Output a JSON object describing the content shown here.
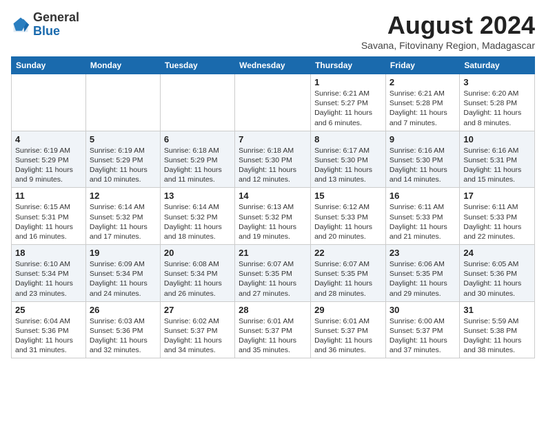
{
  "logo": {
    "general": "General",
    "blue": "Blue"
  },
  "header": {
    "month_year": "August 2024",
    "subtitle": "Savana, Fitovinany Region, Madagascar"
  },
  "weekdays": [
    "Sunday",
    "Monday",
    "Tuesday",
    "Wednesday",
    "Thursday",
    "Friday",
    "Saturday"
  ],
  "weeks": [
    [
      {
        "day": "",
        "info": ""
      },
      {
        "day": "",
        "info": ""
      },
      {
        "day": "",
        "info": ""
      },
      {
        "day": "",
        "info": ""
      },
      {
        "day": "1",
        "info": "Sunrise: 6:21 AM\nSunset: 5:27 PM\nDaylight: 11 hours and 6 minutes."
      },
      {
        "day": "2",
        "info": "Sunrise: 6:21 AM\nSunset: 5:28 PM\nDaylight: 11 hours and 7 minutes."
      },
      {
        "day": "3",
        "info": "Sunrise: 6:20 AM\nSunset: 5:28 PM\nDaylight: 11 hours and 8 minutes."
      }
    ],
    [
      {
        "day": "4",
        "info": "Sunrise: 6:19 AM\nSunset: 5:29 PM\nDaylight: 11 hours and 9 minutes."
      },
      {
        "day": "5",
        "info": "Sunrise: 6:19 AM\nSunset: 5:29 PM\nDaylight: 11 hours and 10 minutes."
      },
      {
        "day": "6",
        "info": "Sunrise: 6:18 AM\nSunset: 5:29 PM\nDaylight: 11 hours and 11 minutes."
      },
      {
        "day": "7",
        "info": "Sunrise: 6:18 AM\nSunset: 5:30 PM\nDaylight: 11 hours and 12 minutes."
      },
      {
        "day": "8",
        "info": "Sunrise: 6:17 AM\nSunset: 5:30 PM\nDaylight: 11 hours and 13 minutes."
      },
      {
        "day": "9",
        "info": "Sunrise: 6:16 AM\nSunset: 5:30 PM\nDaylight: 11 hours and 14 minutes."
      },
      {
        "day": "10",
        "info": "Sunrise: 6:16 AM\nSunset: 5:31 PM\nDaylight: 11 hours and 15 minutes."
      }
    ],
    [
      {
        "day": "11",
        "info": "Sunrise: 6:15 AM\nSunset: 5:31 PM\nDaylight: 11 hours and 16 minutes."
      },
      {
        "day": "12",
        "info": "Sunrise: 6:14 AM\nSunset: 5:32 PM\nDaylight: 11 hours and 17 minutes."
      },
      {
        "day": "13",
        "info": "Sunrise: 6:14 AM\nSunset: 5:32 PM\nDaylight: 11 hours and 18 minutes."
      },
      {
        "day": "14",
        "info": "Sunrise: 6:13 AM\nSunset: 5:32 PM\nDaylight: 11 hours and 19 minutes."
      },
      {
        "day": "15",
        "info": "Sunrise: 6:12 AM\nSunset: 5:33 PM\nDaylight: 11 hours and 20 minutes."
      },
      {
        "day": "16",
        "info": "Sunrise: 6:11 AM\nSunset: 5:33 PM\nDaylight: 11 hours and 21 minutes."
      },
      {
        "day": "17",
        "info": "Sunrise: 6:11 AM\nSunset: 5:33 PM\nDaylight: 11 hours and 22 minutes."
      }
    ],
    [
      {
        "day": "18",
        "info": "Sunrise: 6:10 AM\nSunset: 5:34 PM\nDaylight: 11 hours and 23 minutes."
      },
      {
        "day": "19",
        "info": "Sunrise: 6:09 AM\nSunset: 5:34 PM\nDaylight: 11 hours and 24 minutes."
      },
      {
        "day": "20",
        "info": "Sunrise: 6:08 AM\nSunset: 5:34 PM\nDaylight: 11 hours and 26 minutes."
      },
      {
        "day": "21",
        "info": "Sunrise: 6:07 AM\nSunset: 5:35 PM\nDaylight: 11 hours and 27 minutes."
      },
      {
        "day": "22",
        "info": "Sunrise: 6:07 AM\nSunset: 5:35 PM\nDaylight: 11 hours and 28 minutes."
      },
      {
        "day": "23",
        "info": "Sunrise: 6:06 AM\nSunset: 5:35 PM\nDaylight: 11 hours and 29 minutes."
      },
      {
        "day": "24",
        "info": "Sunrise: 6:05 AM\nSunset: 5:36 PM\nDaylight: 11 hours and 30 minutes."
      }
    ],
    [
      {
        "day": "25",
        "info": "Sunrise: 6:04 AM\nSunset: 5:36 PM\nDaylight: 11 hours and 31 minutes."
      },
      {
        "day": "26",
        "info": "Sunrise: 6:03 AM\nSunset: 5:36 PM\nDaylight: 11 hours and 32 minutes."
      },
      {
        "day": "27",
        "info": "Sunrise: 6:02 AM\nSunset: 5:37 PM\nDaylight: 11 hours and 34 minutes."
      },
      {
        "day": "28",
        "info": "Sunrise: 6:01 AM\nSunset: 5:37 PM\nDaylight: 11 hours and 35 minutes."
      },
      {
        "day": "29",
        "info": "Sunrise: 6:01 AM\nSunset: 5:37 PM\nDaylight: 11 hours and 36 minutes."
      },
      {
        "day": "30",
        "info": "Sunrise: 6:00 AM\nSunset: 5:37 PM\nDaylight: 11 hours and 37 minutes."
      },
      {
        "day": "31",
        "info": "Sunrise: 5:59 AM\nSunset: 5:38 PM\nDaylight: 11 hours and 38 minutes."
      }
    ]
  ]
}
